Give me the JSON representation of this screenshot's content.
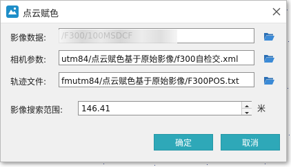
{
  "window": {
    "title": "点云赋色"
  },
  "fields": [
    {
      "label": "影像数据:",
      "value": "/F300/100MSDCF"
    },
    {
      "label": "相机参数:",
      "value": "utm84/点云赋色基于原始影像/f300自检交.xml"
    },
    {
      "label": "轨迹文件:",
      "value": "fmutm84/点云赋色基于原始影像/F300POS.txt"
    }
  ],
  "search_range": {
    "label": "影像搜索范围:",
    "value": "146.41",
    "unit": "米"
  },
  "buttons": {
    "ok": "确定",
    "cancel": "取消"
  },
  "icons": {
    "app": "app-logo-icon",
    "close": "close-icon",
    "browse": "folder-open-icon",
    "spin_up": "spin-up-icon",
    "spin_down": "spin-down-icon"
  },
  "colors": {
    "accent": "#2ea8b8",
    "folder": "#2a6fb5",
    "logo": "#1e8ec8"
  }
}
